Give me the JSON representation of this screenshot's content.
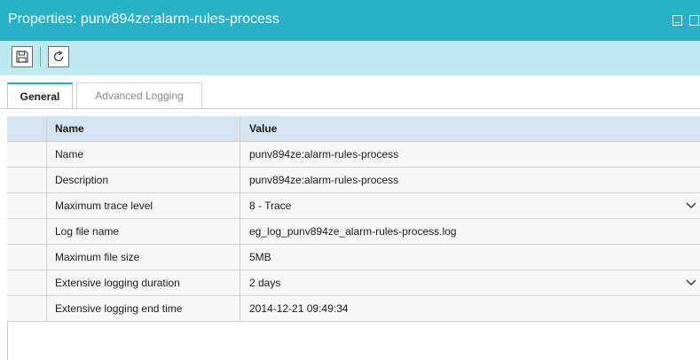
{
  "window": {
    "title": "Properties: punv894ze:alarm-rules-process",
    "minimize_icon": "minimize-icon",
    "restore_icon": "restore-icon"
  },
  "toolbar": {
    "save_icon": "save-icon",
    "refresh_icon": "refresh-icon"
  },
  "tabs": [
    {
      "label": "General",
      "selected": true
    },
    {
      "label": "Advanced Logging",
      "selected": false
    }
  ],
  "colors": {
    "titlebar": "#27b1c7",
    "toolbar": "#bdeaf0",
    "grid_header": "#d6e4f1"
  },
  "grid": {
    "columns": [
      "Name",
      "Value"
    ],
    "rows": [
      {
        "name": "Name",
        "value": "punv894ze:alarm-rules-process",
        "dropdown": false
      },
      {
        "name": "Description",
        "value": "punv894ze:alarm-rules-process",
        "dropdown": false
      },
      {
        "name": "Maximum trace level",
        "value": "8 - Trace",
        "dropdown": true
      },
      {
        "name": "Log file name",
        "value": "eg_log_punv894ze_alarm-rules-process.log",
        "dropdown": false
      },
      {
        "name": "Maximum file size",
        "value": "5MB",
        "dropdown": false
      },
      {
        "name": "Extensive logging duration",
        "value": "2 days",
        "dropdown": true
      },
      {
        "name": "Extensive logging end time",
        "value": "2014-12-21 09:49:34",
        "dropdown": false
      }
    ]
  }
}
